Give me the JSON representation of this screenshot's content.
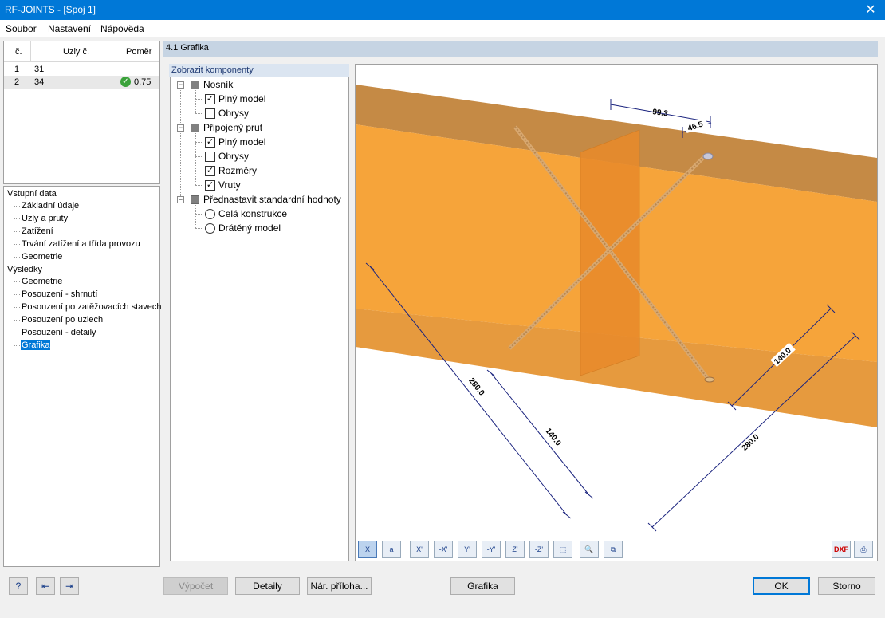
{
  "window": {
    "title": "RF-JOINTS - [Spoj 1]",
    "close_glyph": "✕"
  },
  "menu": {
    "items": [
      {
        "label": "Soubor"
      },
      {
        "label": "Nastavení"
      },
      {
        "label": "Nápověda"
      }
    ]
  },
  "nodes_table": {
    "headers": {
      "no": "č.",
      "nodes": "Uzly č.",
      "ratio": "Poměr"
    },
    "rows": [
      {
        "no": "1",
        "nodes": "31",
        "ratio": ""
      },
      {
        "no": "2",
        "nodes": "34",
        "ratio": "0.75",
        "status_icon": "check-circle-icon"
      }
    ]
  },
  "navigator": {
    "input_group": "Vstupní data",
    "input_items": [
      "Základní údaje",
      "Uzly a pruty",
      "Zatížení",
      "Trvání zatížení a třída provozu",
      "Geometrie"
    ],
    "results_group": "Výsledky",
    "result_items": [
      "Geometrie",
      "Posouzení - shrnutí",
      "Posouzení po zatěžovacích stavech",
      "Posouzení po uzlech",
      "Posouzení - detaily",
      "Grafika"
    ],
    "selected": "Grafika"
  },
  "section": {
    "title": "4.1 Grafika"
  },
  "components": {
    "tab_label": "Zobrazit komponenty",
    "groups": [
      {
        "label": "Nosník",
        "items": [
          {
            "label": "Plný model",
            "checked": true
          },
          {
            "label": "Obrysy",
            "checked": false
          }
        ]
      },
      {
        "label": "Připojený prut",
        "items": [
          {
            "label": "Plný model",
            "checked": true
          },
          {
            "label": "Obrysy",
            "checked": false
          },
          {
            "label": "Rozměry",
            "checked": true
          },
          {
            "label": "Vruty",
            "checked": true
          }
        ]
      },
      {
        "label": "Přednastavit standardní hodnoty",
        "radios": [
          {
            "label": "Celá konstrukce"
          },
          {
            "label": "Drátěný model"
          }
        ]
      }
    ]
  },
  "view": {
    "dimensions": {
      "d1": "99.3",
      "d2": "46.5",
      "d3": "280.0",
      "d4": "140.0",
      "d5": "140.0",
      "d6": "280.0"
    },
    "colors": {
      "beam_top": "#c58a45",
      "beam_front": "#f6a43a",
      "beam_bottom": "#e69a3e",
      "member": "#e8892a",
      "dimension": "#1a237e"
    },
    "toolbar": [
      "view-x-icon",
      "view-a-icon",
      "view-xprime-icon",
      "view-minus-xprime-icon",
      "view-yprime-icon",
      "view-minus-yprime-icon",
      "view-zprime-icon",
      "view-minus-zprime-icon",
      "view-iso-icon",
      "zoom-reset-icon",
      "copy-icon",
      "dxf-export-icon",
      "print-icon"
    ],
    "toolbar_labels": {
      "x": "X",
      "a": "a",
      "xp": "X'",
      "mxp": "-X'",
      "yp": "Y'",
      "myp": "-Y'",
      "zp": "Z'",
      "mzp": "-Z'",
      "iso": "⬚",
      "zoom": "🔍",
      "copy": "⧉",
      "dxf": "DXF",
      "print": "⎙"
    }
  },
  "buttons": {
    "calc": "Výpočet",
    "details": "Detaily",
    "annex": "Nár. příloha...",
    "graphics": "Grafika",
    "ok": "OK",
    "cancel": "Storno"
  },
  "bottom_icons": {
    "help": "?",
    "import": "⇤",
    "export": "⇥"
  }
}
